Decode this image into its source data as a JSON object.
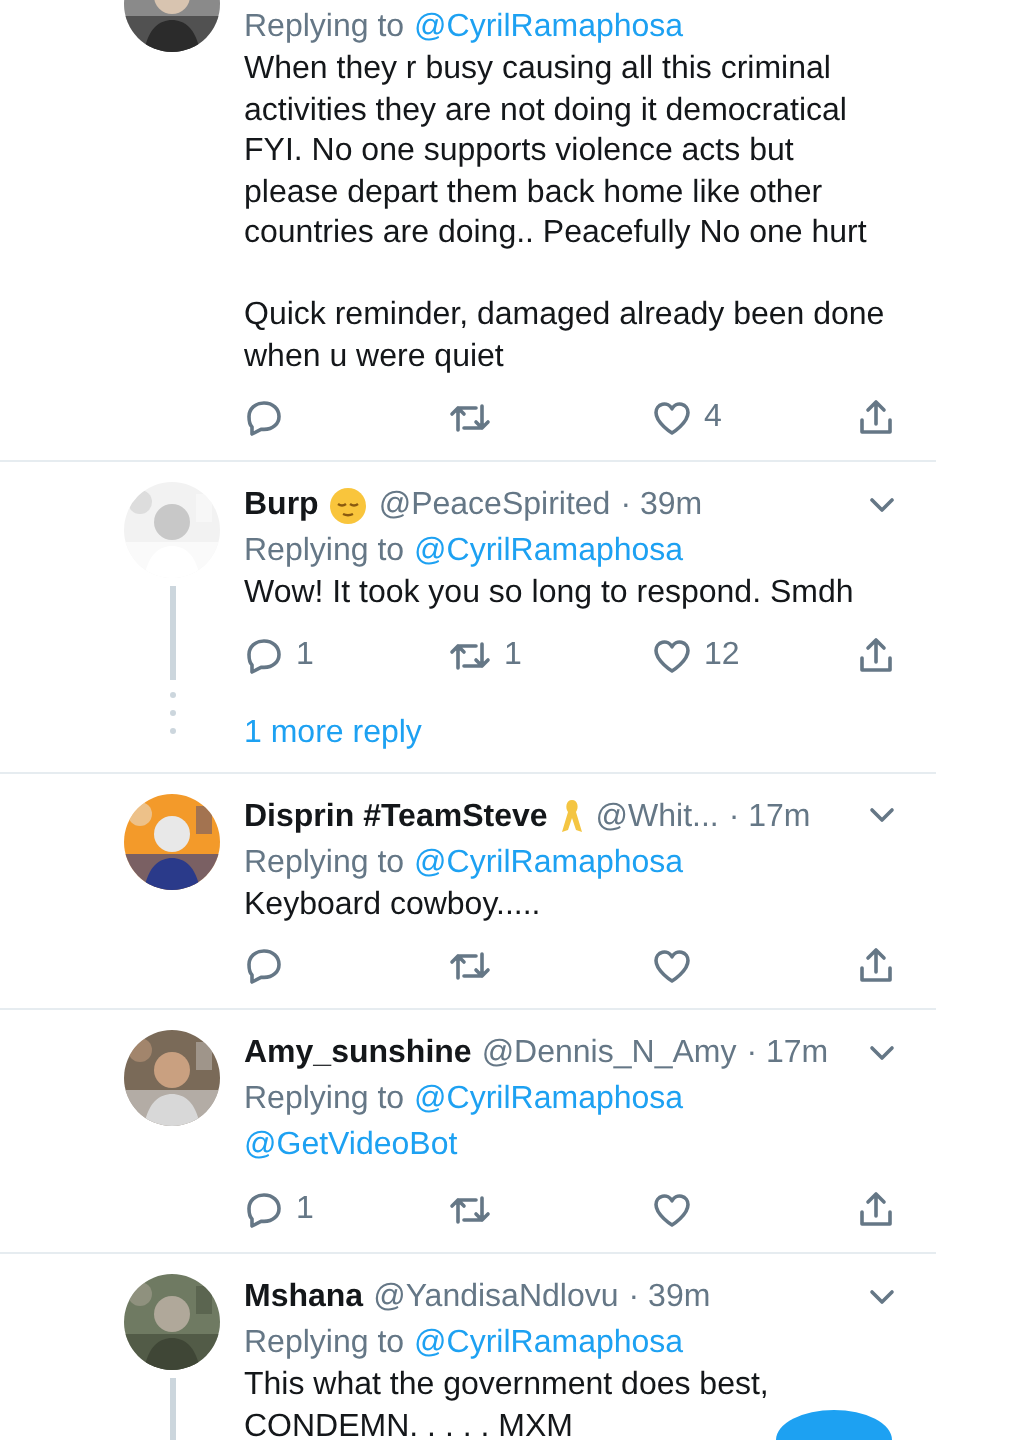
{
  "tweets": [
    {
      "reply_to": "@CyrilRamaphosa",
      "reply_label": "Replying to",
      "text": "When they r busy causing all this criminal activities they are not doing it democratical FYI. No one supports violence acts but please depart them back home like other countries are doing.. Peacefully No one hurt\n\nQuick reminder, damaged already been done when u were quiet",
      "likes": "4",
      "thread_line": false,
      "cut_top": true,
      "actions_visible": true
    },
    {
      "kind": "face-badge",
      "name": "Burp",
      "handle": "@PeaceSpirited",
      "time": "· 39m",
      "reply_label": "Replying to",
      "reply_to": "@CyrilRamaphosa",
      "text": "Wow! It took you so long to respond. Smdh",
      "replies": "1",
      "retweets": "1",
      "likes": "12",
      "thread_line": true,
      "more": "1 more reply",
      "cut_top": false,
      "actions_visible": true
    },
    {
      "kind": "ribbon-badge",
      "name": "Disprin #TeamSteve",
      "handle": "@Whit...",
      "time": "· 17m",
      "reply_label": "Replying to",
      "reply_to": "@CyrilRamaphosa",
      "text": "Keyboard cowboy.....",
      "thread_line": false,
      "cut_top": false,
      "actions_visible": true
    },
    {
      "name": "Amy_sunshine",
      "handle": "@Dennis_N_Amy",
      "time": "· 17m",
      "reply_label": "Replying to",
      "reply_to": "@CyrilRamaphosa",
      "mention_text": "@GetVideoBot",
      "replies": "1",
      "thread_line": false,
      "cut_top": false,
      "kind": "plain",
      "actions_visible": true
    },
    {
      "name": "Mshana",
      "handle": "@YandisaNdlovu",
      "time": "· 39m",
      "reply_label": "Replying to",
      "reply_to": "@CyrilRamaphosa",
      "text": "This what the government does best,\nCONDEMN. . . . . MXM",
      "thread_line": true,
      "cut_top": false,
      "kind": "plain"
    }
  ],
  "compose_button": {
    "visible": true
  }
}
